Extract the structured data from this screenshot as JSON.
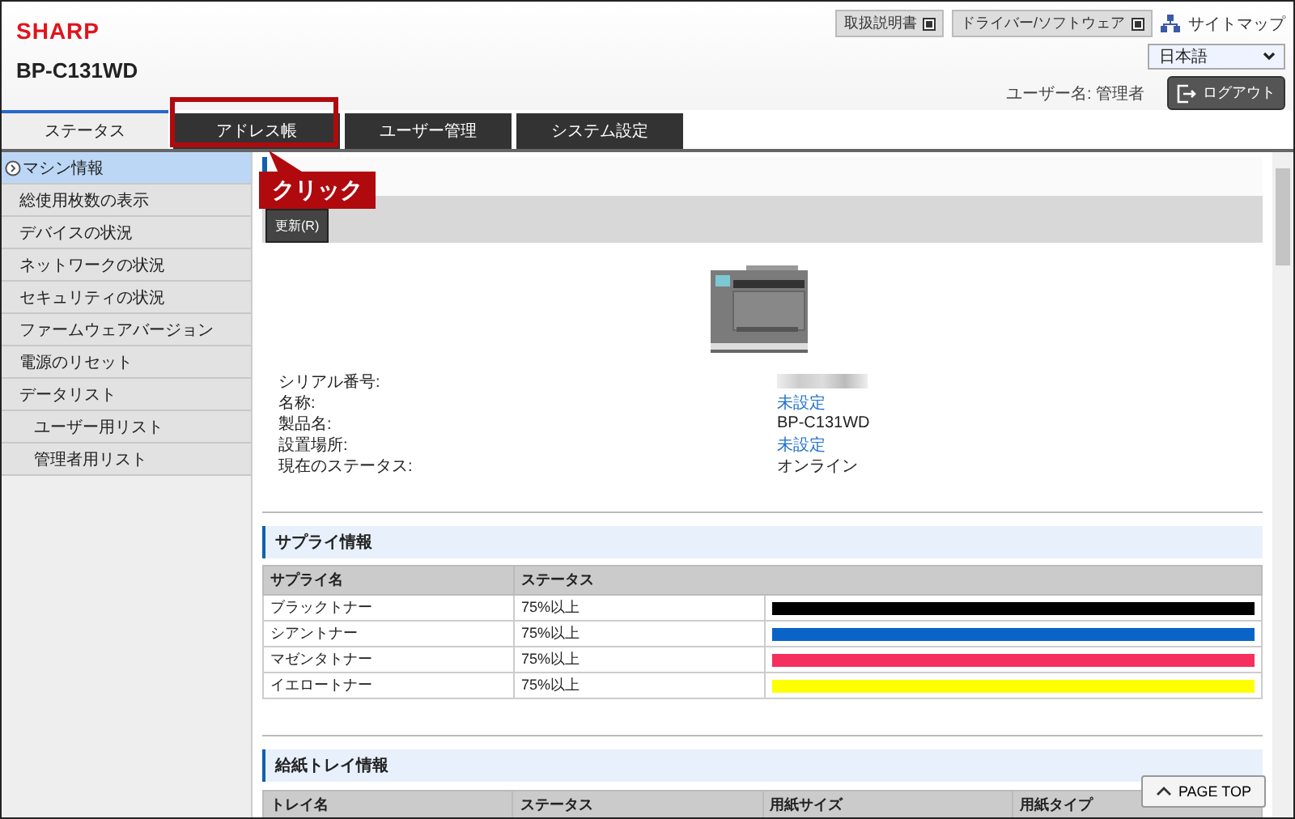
{
  "header": {
    "logo": "SHARP",
    "model": "BP-C131WD",
    "links": [
      {
        "label": "取扱説明書"
      },
      {
        "label": "ドライバー/ソフトウェア"
      }
    ],
    "sitemap": "サイトマップ",
    "language": "日本語",
    "user_label": "ユーザー名: 管理者",
    "logout": "ログアウト"
  },
  "tabs": [
    {
      "label": "ステータス",
      "selected": true
    },
    {
      "label": "アドレス帳",
      "selected": false
    },
    {
      "label": "ユーザー管理",
      "selected": false
    },
    {
      "label": "システム設定",
      "selected": false
    }
  ],
  "sidebar": {
    "items": [
      {
        "label": "マシン情報",
        "selected": true
      },
      {
        "label": "総使用枚数の表示",
        "selected": false
      },
      {
        "label": "デバイスの状況",
        "selected": false
      },
      {
        "label": "ネットワークの状況",
        "selected": false
      },
      {
        "label": "セキュリティの状況",
        "selected": false
      },
      {
        "label": "ファームウェアバージョン",
        "selected": false
      },
      {
        "label": "電源のリセット",
        "selected": false
      },
      {
        "label": "データリスト",
        "selected": false,
        "children": [
          {
            "label": "ユーザー用リスト",
            "selected": false
          },
          {
            "label": "管理者用リスト",
            "selected": false
          }
        ]
      }
    ]
  },
  "toolbar": {
    "refresh": "更新(R)"
  },
  "callout": {
    "label": "クリック"
  },
  "machine": [
    {
      "label": "シリアル番号:",
      "kind": "blurred"
    },
    {
      "label": "名称:",
      "value": "未設定",
      "kind": "link"
    },
    {
      "label": "製品名:",
      "value": "BP-C131WD",
      "kind": "text"
    },
    {
      "label": "設置場所:",
      "value": "未設定",
      "kind": "link"
    },
    {
      "label": "現在のステータス:",
      "value": "オンライン",
      "kind": "text"
    }
  ],
  "supply": {
    "title": "サプライ情報",
    "columns": [
      "サプライ名",
      "ステータス"
    ],
    "rows": [
      {
        "name": "ブラックトナー",
        "status": "75%以上",
        "level": 1,
        "color": "#000000"
      },
      {
        "name": "シアントナー",
        "status": "75%以上",
        "level": 1,
        "color": "#0a64c8"
      },
      {
        "name": "マゼンタトナー",
        "status": "75%以上",
        "level": 1,
        "color": "#f5305f"
      },
      {
        "name": "イエロートナー",
        "status": "75%以上",
        "level": 1,
        "color": "#ffff00"
      }
    ]
  },
  "tray": {
    "title": "給紙トレイ情報",
    "columns": [
      "トレイ名",
      "ステータス",
      "用紙サイズ",
      "用紙タイプ"
    ]
  },
  "page_top": "PAGE TOP"
}
